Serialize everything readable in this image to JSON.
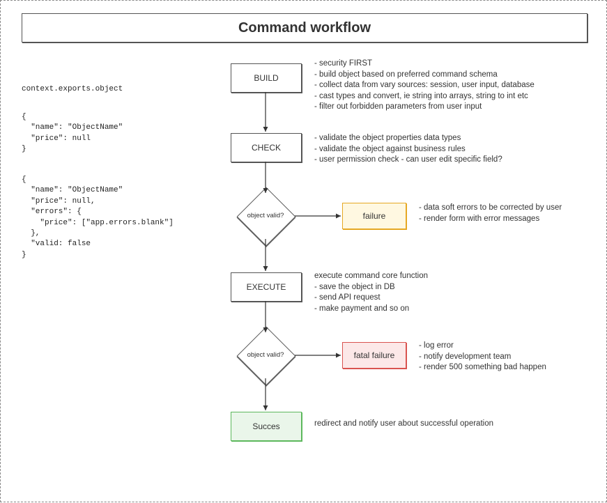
{
  "title": "Command workflow",
  "code_header": "context.exports.object",
  "code_obj1": "{\n  \"name\": \"ObjectName\"\n  \"price\": null\n}",
  "code_obj2": "{\n  \"name\": \"ObjectName\"\n  \"price\": null,\n  \"errors\": {\n    \"price\": [\"app.errors.blank\"]\n  },\n  \"valid: false\n}",
  "nodes": {
    "build": "BUILD",
    "check": "CHECK",
    "execute": "EXECUTE",
    "failure": "failure",
    "fatal": "fatal failure",
    "success": "Succes"
  },
  "diamond_label": "object valid?",
  "notes": {
    "build": "- security FIRST\n- build object based on preferred command schema\n- collect data from vary sources: session, user input, database\n- cast types and convert, ie string into arrays, string to int etc\n- filter out forbidden parameters from user input",
    "check": "- validate the object properties data types\n- validate the object against business rules\n- user permission check - can user edit specific field?",
    "failure": "- data soft errors to be corrected by user\n- render form with error messages",
    "execute": "execute command core function\n- save the object in DB\n- send API request\n- make payment and so on",
    "fatal": "- log error\n- notify development team\n- render 500 something bad happen",
    "success": "redirect and notify user about successful operation"
  }
}
